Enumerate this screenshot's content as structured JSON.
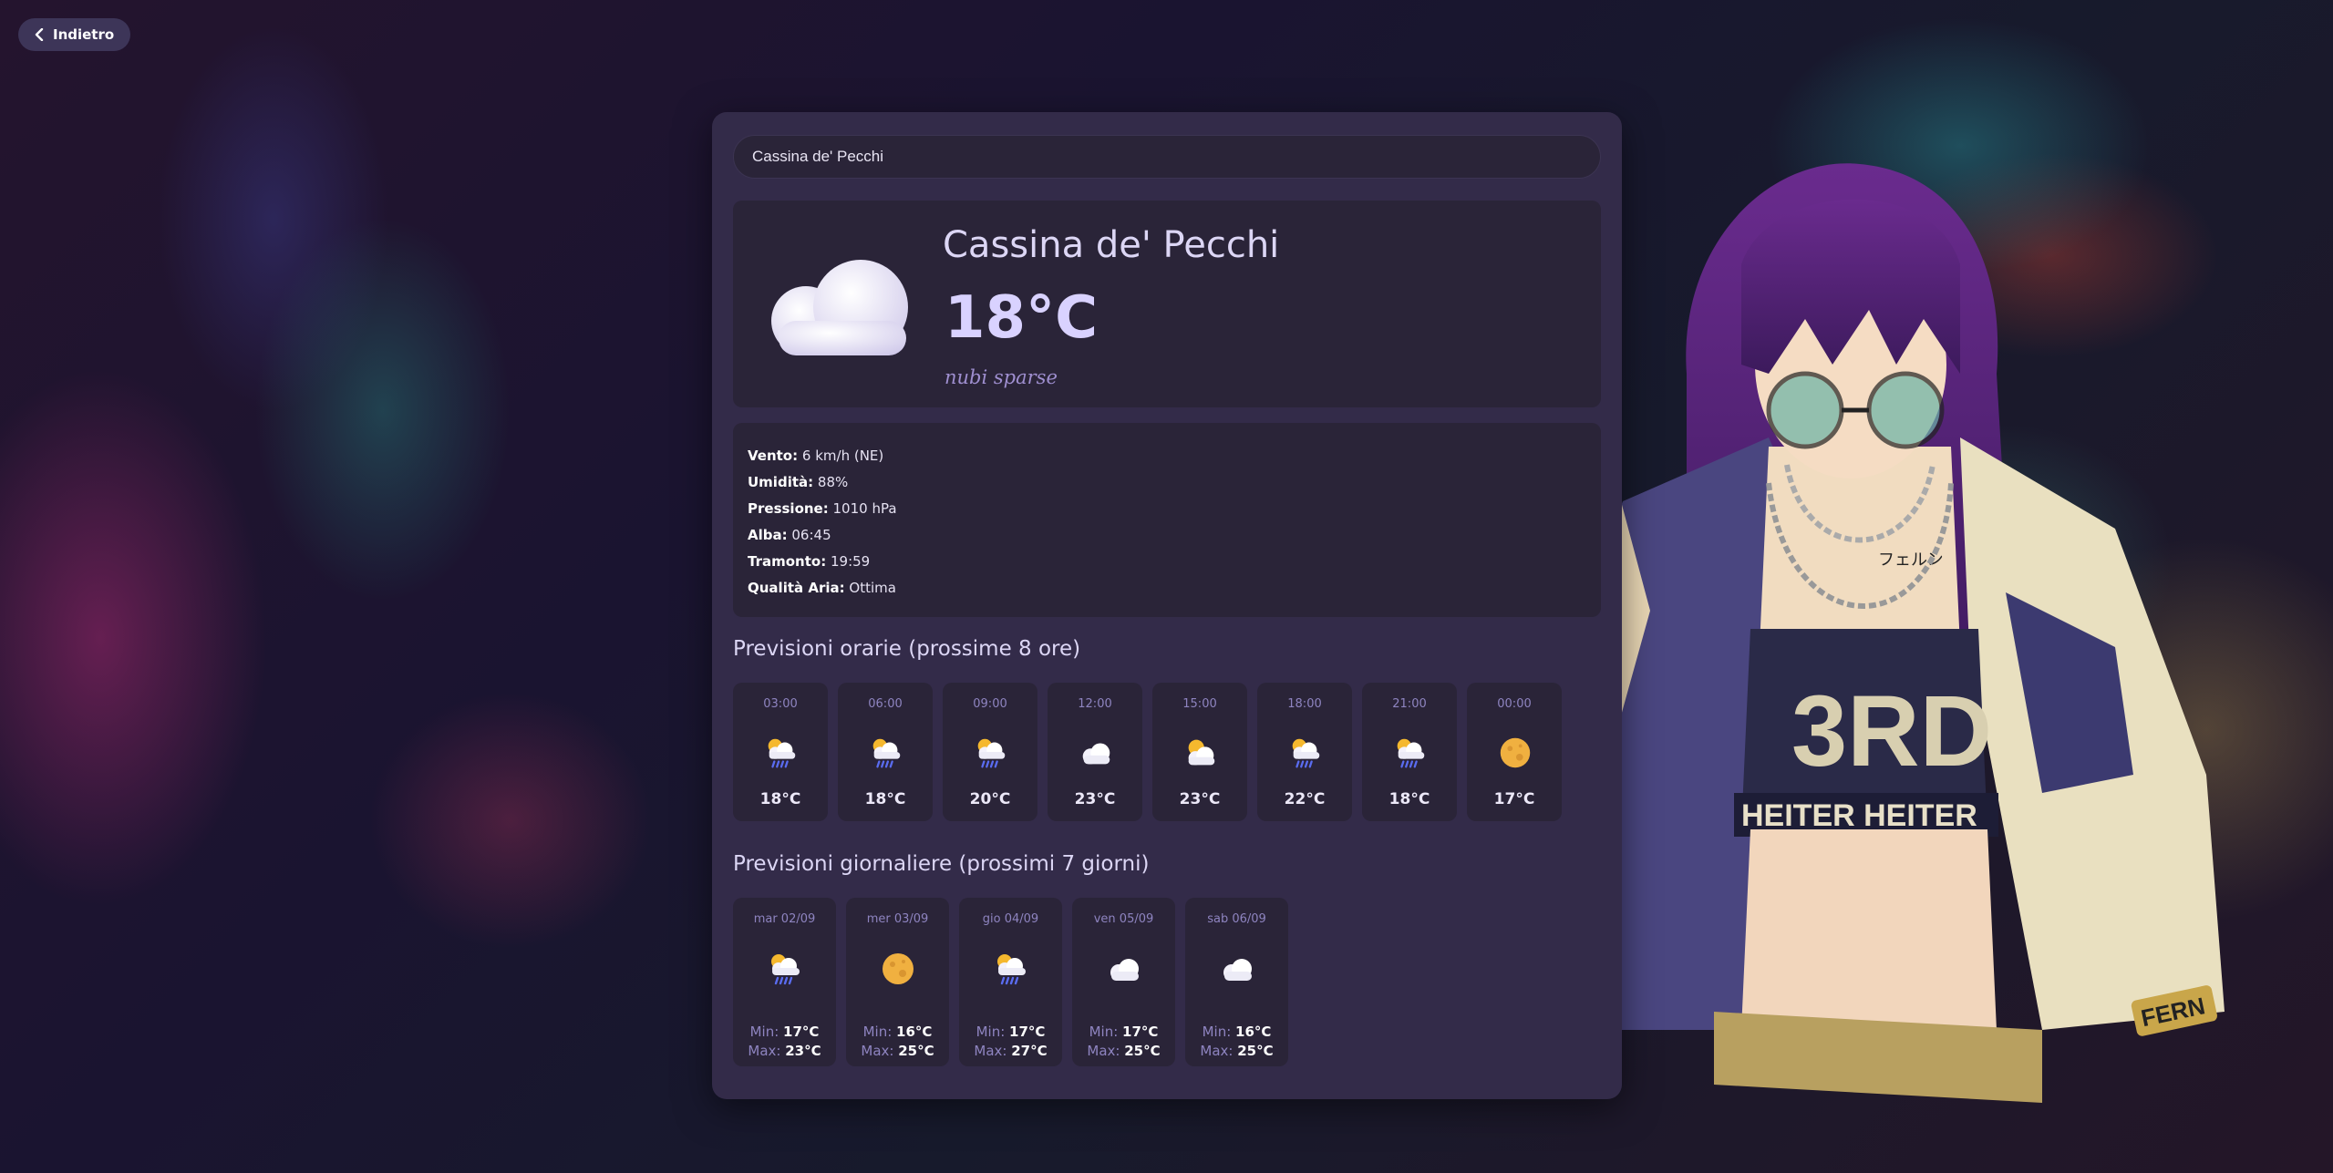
{
  "nav": {
    "back_label": "Indietro"
  },
  "search": {
    "value": "Cassina de' Pecchi"
  },
  "current": {
    "city": "Cassina de' Pecchi",
    "temperature": "18°C",
    "description": "nubi sparse",
    "icon": "cloud-icon"
  },
  "details": [
    {
      "label": "Vento:",
      "value": "6 km/h (NE)"
    },
    {
      "label": "Umidità:",
      "value": "88%"
    },
    {
      "label": "Pressione:",
      "value": "1010 hPa"
    },
    {
      "label": "Alba:",
      "value": "06:45"
    },
    {
      "label": "Tramonto:",
      "value": "19:59"
    },
    {
      "label": "Qualità Aria:",
      "value": "Ottima"
    }
  ],
  "hourly_title": "Previsioni orarie (prossime 8 ore)",
  "hourly": [
    {
      "time": "03:00",
      "temp": "18°C",
      "icon": "sun-cloud-rain-icon"
    },
    {
      "time": "06:00",
      "temp": "18°C",
      "icon": "sun-cloud-rain-icon"
    },
    {
      "time": "09:00",
      "temp": "20°C",
      "icon": "sun-cloud-rain-icon"
    },
    {
      "time": "12:00",
      "temp": "23°C",
      "icon": "cloud-icon"
    },
    {
      "time": "15:00",
      "temp": "23°C",
      "icon": "sun-cloud-icon"
    },
    {
      "time": "18:00",
      "temp": "22°C",
      "icon": "sun-cloud-rain-icon"
    },
    {
      "time": "21:00",
      "temp": "18°C",
      "icon": "sun-cloud-rain-icon"
    },
    {
      "time": "00:00",
      "temp": "17°C",
      "icon": "moon-icon"
    }
  ],
  "daily_title": "Previsioni giornaliere (prossimi 7 giorni)",
  "daily": [
    {
      "date": "mar 02/09",
      "min_label": "Min:",
      "min": "17°C",
      "max_label": "Max:",
      "max": "23°C",
      "icon": "sun-cloud-rain-icon"
    },
    {
      "date": "mer 03/09",
      "min_label": "Min:",
      "min": "16°C",
      "max_label": "Max:",
      "max": "25°C",
      "icon": "moon-icon"
    },
    {
      "date": "gio 04/09",
      "min_label": "Min:",
      "min": "17°C",
      "max_label": "Max:",
      "max": "27°C",
      "icon": "sun-cloud-rain-icon"
    },
    {
      "date": "ven 05/09",
      "min_label": "Min:",
      "min": "17°C",
      "max_label": "Max:",
      "max": "25°C",
      "icon": "cloud-icon"
    },
    {
      "date": "sab 06/09",
      "min_label": "Min:",
      "min": "16°C",
      "max_label": "Max:",
      "max": "25°C",
      "icon": "cloud-icon"
    }
  ],
  "illustration": {
    "shirt_text": "3RD",
    "band_text": "HEITER HEITER",
    "sleeve_text": "フェルン",
    "patch_text": "FERN"
  }
}
